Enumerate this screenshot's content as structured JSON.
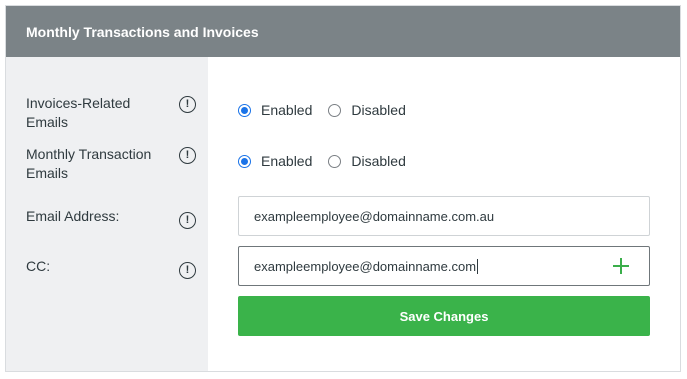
{
  "panel": {
    "title": "Monthly Transactions and Invoices"
  },
  "fields": {
    "invoices_emails": {
      "label": "Invoices-Related Emails",
      "options": [
        "Enabled",
        "Disabled"
      ],
      "selected": "Enabled"
    },
    "monthly_emails": {
      "label": "Monthly Transaction Emails",
      "options": [
        "Enabled",
        "Disabled"
      ],
      "selected": "Enabled"
    },
    "email_address": {
      "label": "Email Address:",
      "value": "exampleemployee@domainname.com.au"
    },
    "cc": {
      "label": "CC:",
      "value": "exampleemployee@domainname.com"
    }
  },
  "icons": {
    "info": "info-circle-icon",
    "add": "plus-icon"
  },
  "buttons": {
    "save_label": "Save Changes"
  },
  "colors": {
    "header_bg": "#7b8387",
    "label_col_bg": "#eff0f2",
    "radio_accent": "#1a73e8",
    "primary_button": "#3ab34a"
  }
}
